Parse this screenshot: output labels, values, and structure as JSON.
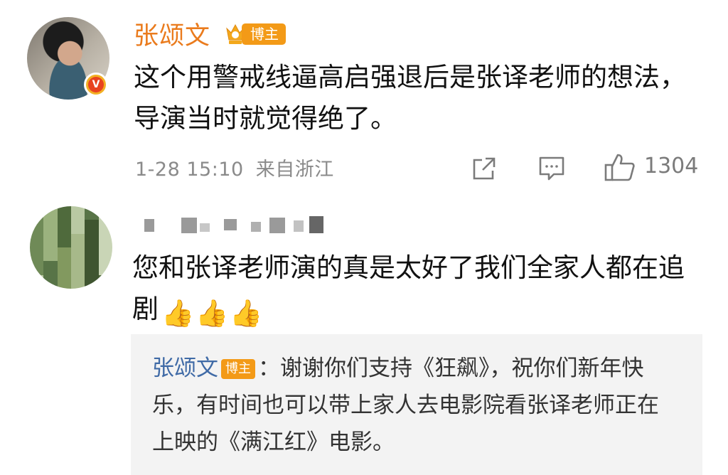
{
  "comment": {
    "author": "张颂文",
    "author_tag": "博主",
    "verified_badge": "V",
    "text": "这个用警戒线逼高启强退后是张译老师的想法，导演当时就觉得绝了。",
    "timestamp": "1-28 15:10",
    "location": "来自浙江",
    "like_count": "1304",
    "icons": [
      "share-icon",
      "comment-icon",
      "like-icon"
    ]
  },
  "reply": {
    "text": "您和张译老师演的真是太好了我们全家人都在追剧",
    "emoji": [
      "👍",
      "👍",
      "👍"
    ],
    "sub_reply": {
      "author": "张颂文",
      "author_tag": "博主",
      "text": "：谢谢你们支持《狂飙》，祝你们新年快乐，有时间也可以带上家人去电影院看张译老师正在上映的《满江红》电影。"
    }
  },
  "colors": {
    "author_orange": "#ea7b1d",
    "tag_orange": "#f39a17",
    "reply_name_blue": "#3f6aa6",
    "meta_gray": "#8a8a8a",
    "reply_bg": "#f3f3f3"
  }
}
